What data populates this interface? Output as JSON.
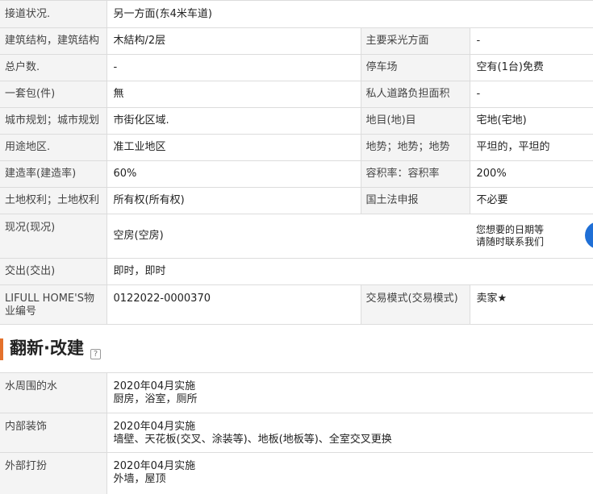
{
  "spec_table": {
    "rows": [
      {
        "label": "接道状况.",
        "value": "另一方面(东4米车道)"
      },
      {
        "label": "建筑结构，建筑结构",
        "value": "木結构/2层",
        "label2": "主要采光方面",
        "value2": "-"
      },
      {
        "label": "总户数.",
        "value": "-",
        "label2": "停车场",
        "value2": "空有(1台)免费"
      },
      {
        "label": "一套包(件)",
        "value": "無",
        "label2": "私人道路负担面积",
        "value2": "-"
      },
      {
        "label": "城市规划；城市规划",
        "value": "市街化区域.",
        "label2": "地目(地)目",
        "value2": "宅地(宅地)"
      },
      {
        "label": "用途地区.",
        "value": "准工业地区",
        "label2": "地势；地势；地势",
        "value2": "平坦的，平坦的"
      },
      {
        "label": "建造率(建造率)",
        "value": "60%",
        "label2": "容积率：容积率",
        "value2": "200%"
      },
      {
        "label": "土地权利；土地权利",
        "value": "所有权(所有权)",
        "label2": "国土法申报",
        "value2": "不必要"
      },
      {
        "label": "现况(现况)",
        "value": "空房(空房)",
        "inquiry_line1": "您想要的日期等",
        "inquiry_line2": "请随时联系我们"
      },
      {
        "label": "交出(交出)",
        "value": "即时，即时"
      },
      {
        "label": "LIFULL HOME'S物业编号",
        "value": "0122022-0000370",
        "label2": "交易模式(交易模式)",
        "value2": "卖家★"
      }
    ]
  },
  "reform": {
    "heading": "翻新·改建",
    "help_icon": "?",
    "accent_color": "#e4712b",
    "rows": [
      {
        "label": "水周围的水",
        "date": "2020年04月实施",
        "detail": "厨房，浴室，厕所"
      },
      {
        "label": "内部装饰",
        "date": "2020年04月实施",
        "detail": "墙壁、天花板(交叉、涂装等)、地板(地板等)、全室交叉更换"
      },
      {
        "label": "外部打扮",
        "date": "2020年04月实施",
        "detail": "外墙，屋顶"
      }
    ]
  },
  "chat_button": {
    "icon": "chat-bubble-icon",
    "color": "#1f6fd6"
  }
}
